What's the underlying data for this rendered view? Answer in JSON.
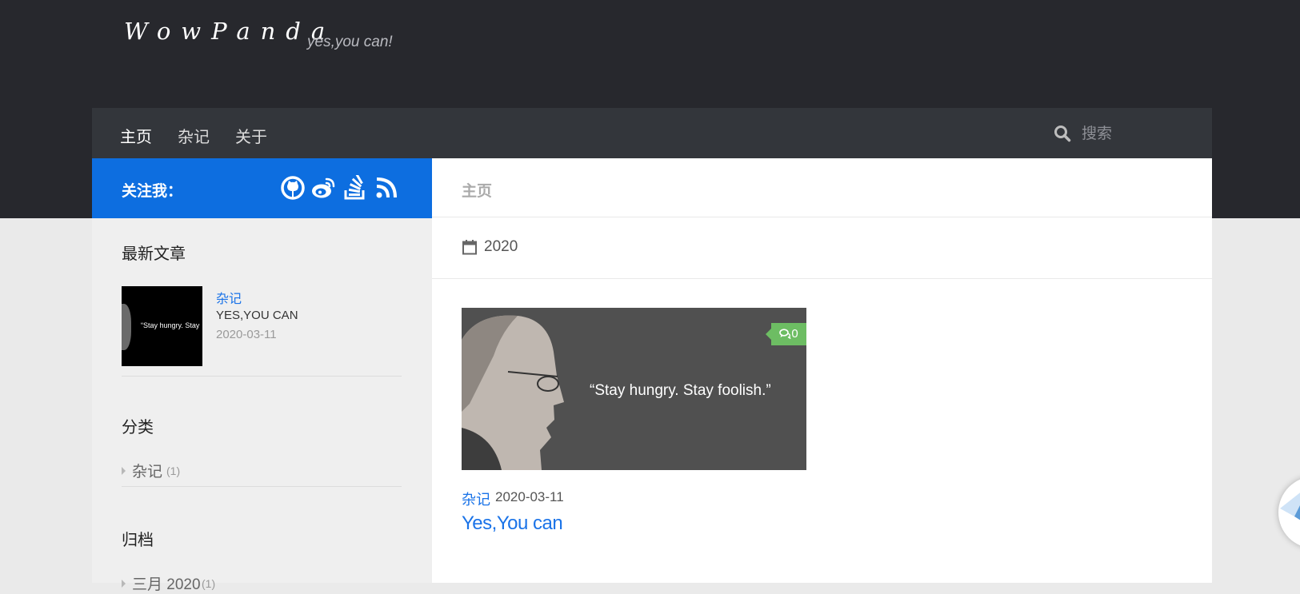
{
  "header": {
    "site_title": "WowPanda",
    "tagline": "yes,you can!"
  },
  "nav": {
    "items": [
      {
        "label": "主页",
        "active": true
      },
      {
        "label": "杂记",
        "active": false
      },
      {
        "label": "关于",
        "active": false
      }
    ],
    "search": {
      "placeholder": "搜索",
      "value": ""
    }
  },
  "follow": {
    "label": "关注我：",
    "icons": [
      "github-icon",
      "weibo-icon",
      "stackoverflow-icon",
      "rss-icon"
    ]
  },
  "sidebar": {
    "recent": {
      "title": "最新文章",
      "items": [
        {
          "thumb_text": "“Stay hungry. Stay",
          "category": "杂记",
          "title": "YES,YOU CAN",
          "date": "2020-03-11"
        }
      ]
    },
    "categories": {
      "title": "分类",
      "items": [
        {
          "name": "杂记",
          "count": "(1)"
        }
      ]
    },
    "archives": {
      "title": "归档",
      "items": [
        {
          "name": "三月 2020",
          "count": "(1)"
        }
      ]
    }
  },
  "main": {
    "page_title": "主页",
    "archive_year": "2020",
    "posts": [
      {
        "image_quote": "“Stay hungry. Stay foolish.”",
        "comments": "0",
        "category": "杂记",
        "date": "2020-03-11",
        "title": "Yes,You can"
      }
    ]
  },
  "colors": {
    "header_bg": "#27282d",
    "nav_bg": "#33363b",
    "accent_blue": "#0d6ee0",
    "link_blue": "#1a73e8",
    "comment_green": "#6dbd63",
    "page_bg": "#eaeaea"
  }
}
